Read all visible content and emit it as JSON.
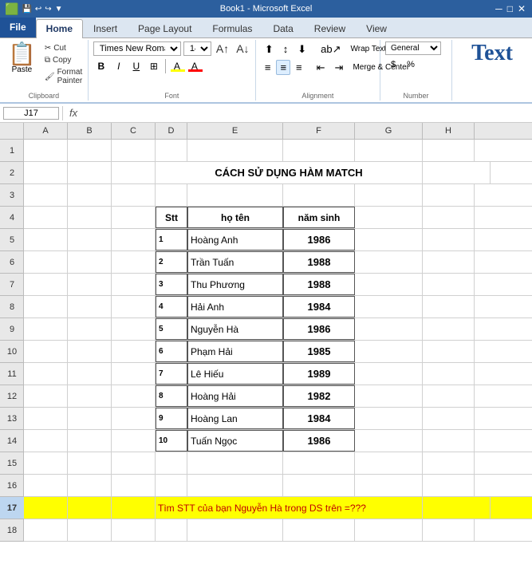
{
  "titlebar": {
    "text": "Book1 - Microsoft Excel"
  },
  "quickaccess": {
    "buttons": [
      "💾",
      "↩",
      "↪",
      "▼"
    ]
  },
  "tabs": {
    "file": "File",
    "items": [
      "Home",
      "Insert",
      "Page Layout",
      "Formulas",
      "Data",
      "Review",
      "View"
    ]
  },
  "ribbon": {
    "clipboard": {
      "paste": "Paste",
      "cut": "Cut",
      "copy": "Copy",
      "format_painter": "Format Painter",
      "label": "Clipboard"
    },
    "font": {
      "family": "Times New Roman",
      "size": "14",
      "bold": "B",
      "italic": "I",
      "underline": "U",
      "border": "⊞",
      "fill": "A",
      "color": "A",
      "label": "Font"
    },
    "alignment": {
      "wrap_text": "Wrap Text",
      "merge_center": "Merge & Center",
      "label": "Alignment"
    },
    "number": {
      "format": "General",
      "label": "Number"
    }
  },
  "formulabar": {
    "cell_ref": "J17",
    "fx": "fx",
    "content": ""
  },
  "columns": [
    "A",
    "B",
    "C",
    "D",
    "E",
    "F",
    "G",
    "H"
  ],
  "rows": [
    {
      "id": 1,
      "cells": [
        "",
        "",
        "",
        "",
        "",
        "",
        "",
        ""
      ]
    },
    {
      "id": 2,
      "cells": [
        "",
        "",
        "",
        "CÁCH SỬ DỤNG HÀM MATCH",
        "",
        "",
        "",
        ""
      ],
      "merged": true,
      "style": "bold center"
    },
    {
      "id": 3,
      "cells": [
        "",
        "",
        "",
        "",
        "",
        "",
        "",
        ""
      ]
    },
    {
      "id": 4,
      "cells": [
        "",
        "",
        "",
        "Stt",
        "họ tên",
        "năm sinh",
        "",
        ""
      ],
      "header": true
    },
    {
      "id": 5,
      "cells": [
        "",
        "",
        "",
        "1",
        "Hoàng Anh",
        "1986",
        "",
        ""
      ]
    },
    {
      "id": 6,
      "cells": [
        "",
        "",
        "",
        "2",
        "Trần Tuấn",
        "1988",
        "",
        ""
      ]
    },
    {
      "id": 7,
      "cells": [
        "",
        "",
        "",
        "3",
        "Thu Phương",
        "1988",
        "",
        ""
      ]
    },
    {
      "id": 8,
      "cells": [
        "",
        "",
        "",
        "4",
        "Hải Anh",
        "1984",
        "",
        ""
      ]
    },
    {
      "id": 9,
      "cells": [
        "",
        "",
        "",
        "5",
        "Nguyễn Hà",
        "1986",
        "",
        ""
      ]
    },
    {
      "id": 10,
      "cells": [
        "",
        "",
        "",
        "6",
        "Phạm Hải",
        "1985",
        "",
        ""
      ]
    },
    {
      "id": 11,
      "cells": [
        "",
        "",
        "",
        "7",
        "Lê Hiếu",
        "1989",
        "",
        ""
      ]
    },
    {
      "id": 12,
      "cells": [
        "",
        "",
        "",
        "8",
        "Hoàng Hải",
        "1982",
        "",
        ""
      ]
    },
    {
      "id": 13,
      "cells": [
        "",
        "",
        "",
        "9",
        "Hoàng Lan",
        "1984",
        "",
        ""
      ]
    },
    {
      "id": 14,
      "cells": [
        "",
        "",
        "",
        "10",
        "Tuấn Ngọc",
        "1986",
        "",
        ""
      ]
    },
    {
      "id": 15,
      "cells": [
        "",
        "",
        "",
        "",
        "",
        "",
        "",
        ""
      ]
    },
    {
      "id": 16,
      "cells": [
        "",
        "",
        "",
        "",
        "",
        "",
        "",
        ""
      ]
    },
    {
      "id": 17,
      "cells": [
        "",
        "",
        "",
        "Tìm  STT của bạn Nguyễn Hà trong DS trên =???",
        "",
        "",
        "",
        ""
      ],
      "highlight": true,
      "merged": true
    },
    {
      "id": 18,
      "cells": [
        "",
        "",
        "",
        "",
        "",
        "",
        "",
        ""
      ]
    }
  ]
}
